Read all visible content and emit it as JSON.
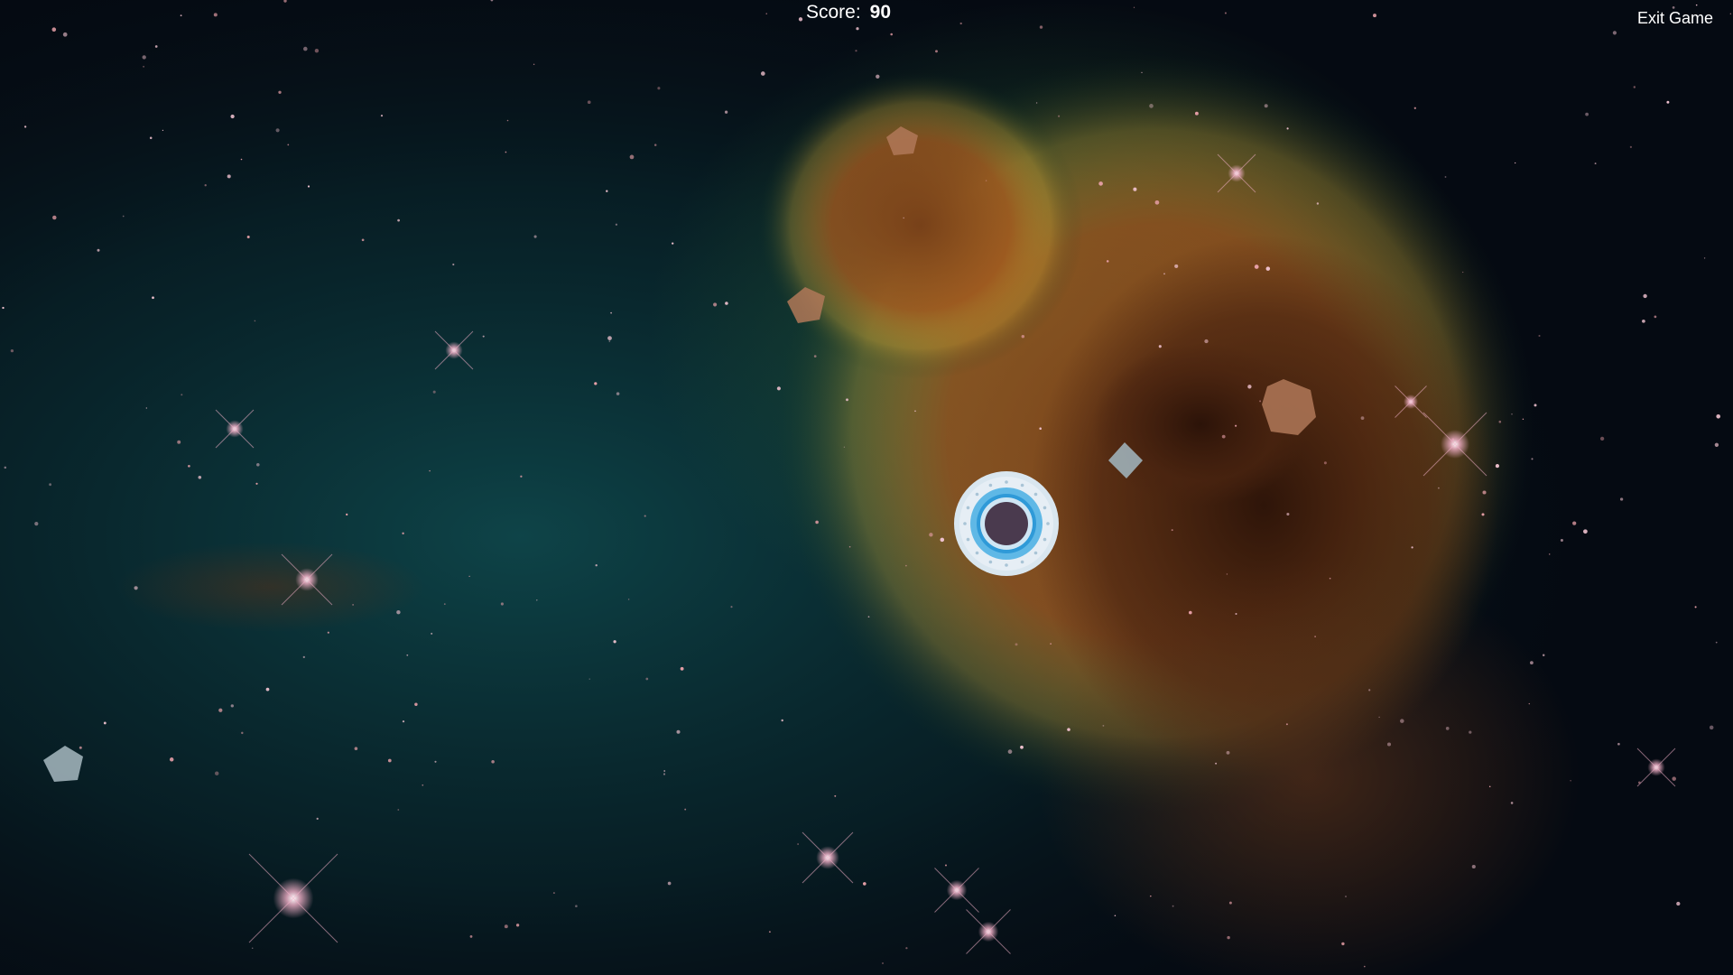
{
  "hud": {
    "score_label": "Score:",
    "score_value": "90",
    "exit_label": "Exit Game"
  },
  "colors": {
    "space": "#050a12",
    "teal_glow": "#0f4a4e",
    "nebula_orange": "#a85a1e",
    "nebula_dark": "#3a1a0c",
    "nebula_edge": "#c9a033",
    "asteroid_brown": "#b07858",
    "asteroid_gray": "#9fb0b8",
    "ship_ring": "#d9e6ef",
    "ship_blue": "#2f9ad8",
    "ship_core": "#4a3a4e",
    "text": "#ffffff"
  },
  "entities": {
    "player_ship": "circular-spaceship",
    "asteroids": [
      {
        "shape": "pentagon",
        "tone": "brown"
      },
      {
        "shape": "pentagon",
        "tone": "brown"
      },
      {
        "shape": "hexagon",
        "tone": "brown"
      },
      {
        "shape": "diamond",
        "tone": "gray"
      },
      {
        "shape": "pentagon",
        "tone": "gray"
      }
    ]
  }
}
